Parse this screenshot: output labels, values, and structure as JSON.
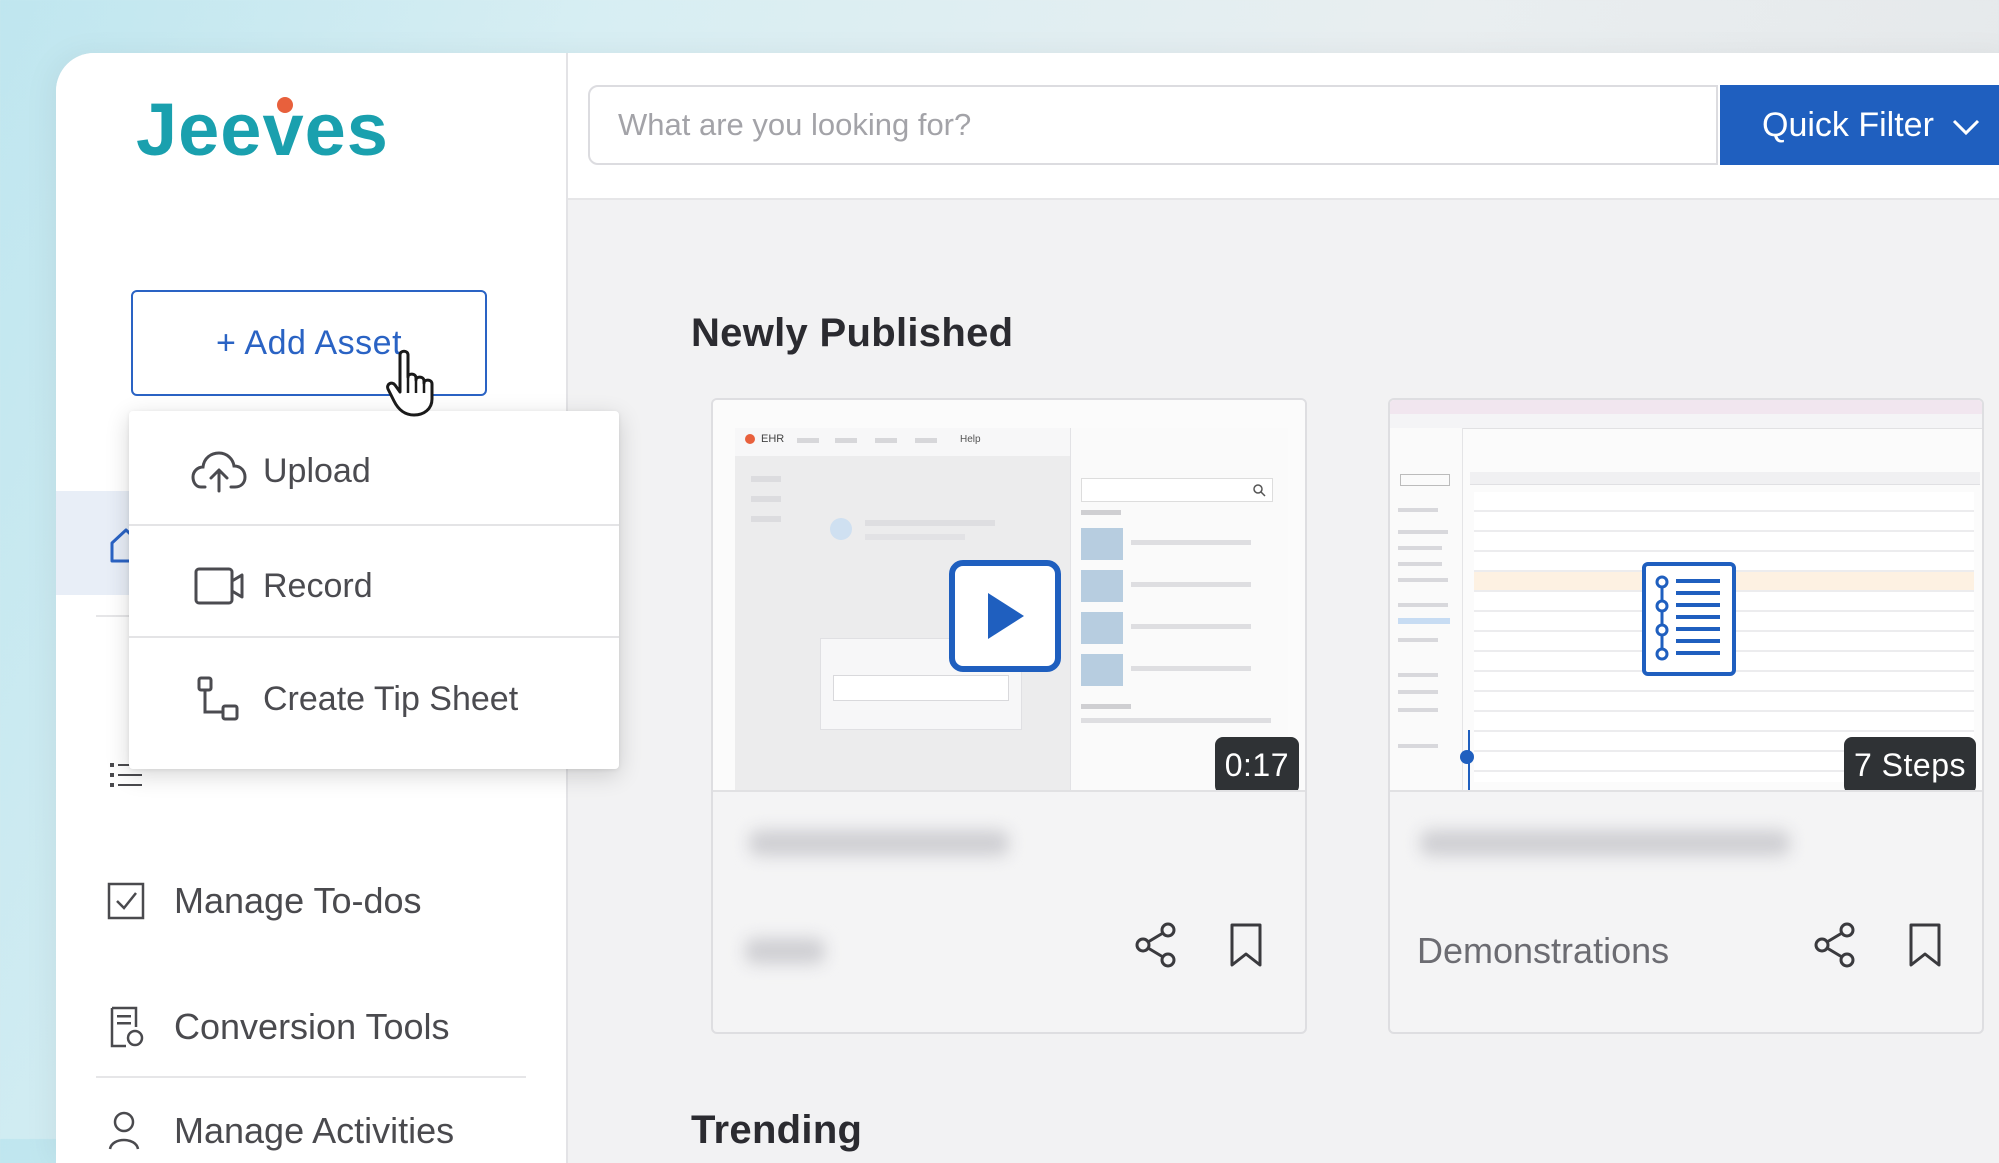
{
  "app": {
    "logo_text": "Jeeves",
    "brand_color": "#1aa0ae",
    "accent_color": "#1f5fbf",
    "logo_dot_color": "#e8603c"
  },
  "sidebar": {
    "add_asset_label": "+ Add Asset",
    "dropdown": {
      "items": [
        {
          "label": "Upload",
          "icon": "cloud-upload-icon"
        },
        {
          "label": "Record",
          "icon": "video-camera-icon"
        },
        {
          "label": "Create Tip Sheet",
          "icon": "flow-steps-icon"
        }
      ]
    },
    "nav": [
      {
        "label": "Home",
        "icon": "home-icon"
      },
      {
        "label": "Library",
        "icon": "list-icon"
      },
      {
        "label": "Manage To-dos",
        "icon": "checkbox-icon"
      },
      {
        "label": "Conversion Tools",
        "icon": "document-convert-icon"
      },
      {
        "label": "Manage Activities",
        "icon": "user-activity-icon"
      }
    ]
  },
  "header": {
    "search_placeholder": "What are you looking for?",
    "quick_filter_label": "Quick Filter"
  },
  "main": {
    "sections": [
      {
        "title": "Newly Published",
        "cards": [
          {
            "type": "video",
            "badge": "0:17",
            "category": "",
            "thumb_label": "EHR",
            "thumb_menu": "Help"
          },
          {
            "type": "tip-sheet",
            "badge": "7 Steps",
            "category": "Demonstrations"
          }
        ]
      },
      {
        "title": "Trending"
      }
    ]
  }
}
